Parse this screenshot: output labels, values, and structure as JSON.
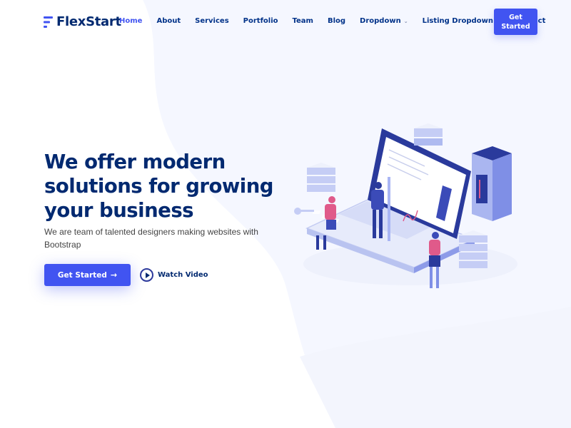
{
  "brand": {
    "name": "FlexStart",
    "color_primary": "#4154f1",
    "color_dark": "#012970"
  },
  "nav": {
    "items": [
      {
        "label": "Home",
        "active": true
      },
      {
        "label": "About"
      },
      {
        "label": "Services"
      },
      {
        "label": "Portfolio"
      },
      {
        "label": "Team"
      },
      {
        "label": "Blog"
      },
      {
        "label": "Dropdown",
        "has_caret": true
      },
      {
        "label": "Listing Dropdown",
        "has_caret": true
      },
      {
        "label": "Contact"
      }
    ],
    "cta_label": "Get Started"
  },
  "hero": {
    "title": "We offer modern solutions for growing your business",
    "subtitle": "We are team of talented designers making websites with Bootstrap",
    "primary_button": "Get Started",
    "primary_button_icon": "arrow-right-icon",
    "video_button": "Watch Video",
    "video_button_icon": "play-circle-icon"
  }
}
